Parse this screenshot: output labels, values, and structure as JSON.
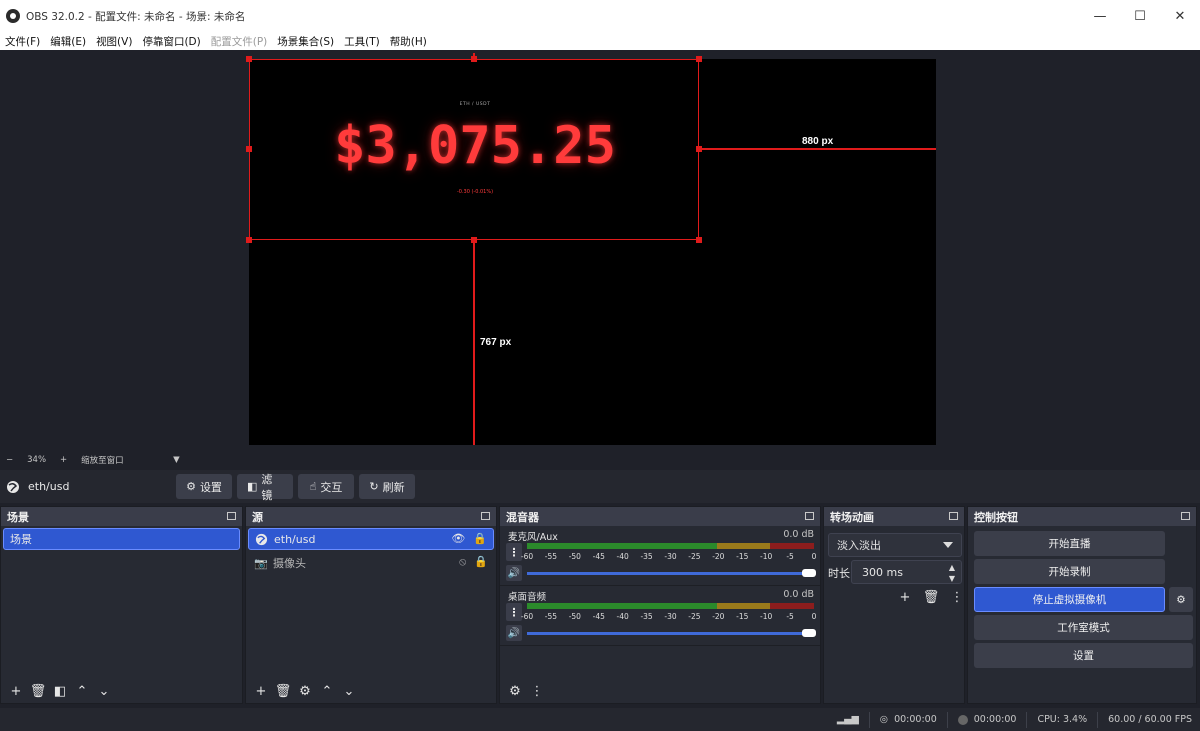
{
  "window": {
    "title": "OBS 32.0.2 - 配置文件: 未命名 - 场景: 未命名",
    "minimize": "—",
    "maximize": "☐",
    "close": "✕"
  },
  "menu": [
    {
      "label": "文件(F)",
      "enabled": true
    },
    {
      "label": "编辑(E)",
      "enabled": true
    },
    {
      "label": "视图(V)",
      "enabled": true
    },
    {
      "label": "停靠窗口(D)",
      "enabled": true
    },
    {
      "label": "配置文件(P)",
      "enabled": false
    },
    {
      "label": "场景集合(S)",
      "enabled": true
    },
    {
      "label": "工具(T)",
      "enabled": true
    },
    {
      "label": "帮助(H)",
      "enabled": true
    }
  ],
  "preview": {
    "ticker_pair": "ETH / USDT",
    "ticker_price": "$3,075.25",
    "ticker_change": "-0.30 (-0.01%)",
    "guide_right_label": "880 px",
    "guide_bottom_label": "767 px",
    "accent_color": "#e01b1b"
  },
  "zoom": {
    "minus": "−",
    "value": "34%",
    "plus": "+",
    "mode": "缩放至窗口"
  },
  "context": {
    "source_name": "eth/usd",
    "buttons": [
      "设置",
      "滤镜",
      "交互",
      "刷新"
    ]
  },
  "scenes": {
    "title": "场景",
    "items": [
      "场景"
    ]
  },
  "sources": {
    "title": "源",
    "items": [
      {
        "name": "eth/usd",
        "visible": true,
        "locked": true
      },
      {
        "name": "摄像头",
        "visible": false,
        "locked": true
      }
    ]
  },
  "mixer": {
    "title": "混音器",
    "scale": [
      "-60",
      "-55",
      "-50",
      "-45",
      "-40",
      "-35",
      "-30",
      "-25",
      "-20",
      "-15",
      "-10",
      "-5",
      "0"
    ],
    "channels": [
      {
        "name": "麦克风/Aux",
        "db": "0.0 dB"
      },
      {
        "name": "桌面音频",
        "db": "0.0 dB"
      }
    ]
  },
  "transitions": {
    "title": "转场动画",
    "selected": "淡入淡出",
    "duration_label": "时长",
    "duration": "300 ms"
  },
  "controls": {
    "title": "控制按钮",
    "buttons": [
      "开始直播",
      "开始录制",
      "停止虚拟摄像机",
      "工作室模式",
      "设置"
    ]
  },
  "status": {
    "stream_time": "00:00:00",
    "record_time": "00:00:00",
    "cpu": "CPU: 3.4%",
    "fps": "60.00 / 60.00 FPS"
  },
  "colors": {
    "selection_blue": "#2f58d1",
    "dock_bg": "#272a33",
    "meter_green": "#2b8a2b",
    "meter_yellow": "#9a7a1b",
    "meter_red": "#8c1d1d"
  }
}
